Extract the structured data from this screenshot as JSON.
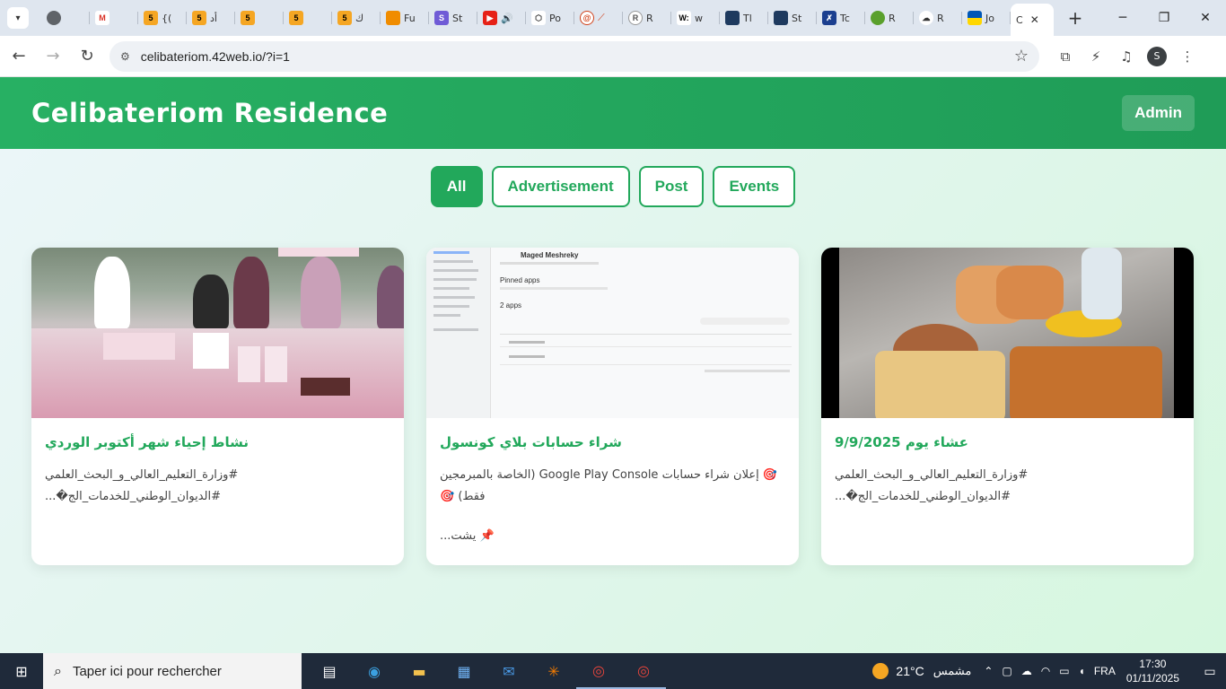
{
  "browser": {
    "tabs": [
      {
        "label": "",
        "icon": "globe-icon"
      },
      {
        "label": "M",
        "icon": "gmail-icon"
      },
      {
        "label": "{(",
        "icon": "five-icon"
      },
      {
        "label": "أد",
        "icon": "five-icon"
      },
      {
        "label": "",
        "icon": "five-icon"
      },
      {
        "label": "",
        "icon": "five-icon"
      },
      {
        "label": "ك",
        "icon": "five-icon"
      },
      {
        "label": "Fu",
        "icon": "fiverr-icon"
      },
      {
        "label": "St",
        "icon": "s-icon"
      },
      {
        "label": "",
        "icon": "youtube-icon"
      },
      {
        "label": "Po",
        "icon": "cube-icon"
      },
      {
        "label": "",
        "icon": "spiral-icon"
      },
      {
        "label": "R",
        "icon": "r-icon"
      },
      {
        "label": "w",
        "icon": "w-icon"
      },
      {
        "label": "Tl",
        "icon": "book-icon"
      },
      {
        "label": "St",
        "icon": "book-icon"
      },
      {
        "label": "Tc",
        "icon": "t-icon"
      },
      {
        "label": "R",
        "icon": "leaf-icon"
      },
      {
        "label": "R",
        "icon": "cloud-icon"
      },
      {
        "label": "Jo",
        "icon": "flag-icon"
      }
    ],
    "active_tab_label": "C",
    "url": "celibateriom.42web.io/?i=1"
  },
  "site": {
    "title": "Celibateriom Residence",
    "admin_label": "Admin",
    "filters": [
      "All",
      "Advertisement",
      "Post",
      "Events"
    ],
    "active_filter": "All"
  },
  "posts": [
    {
      "title": "نشاط إحياء شهر أكتوبر الوردي",
      "text": "#وزارة_التعليم_العالي_و_البحث_العلمي #الديوان_الوطني_للخدمات_الج�..."
    },
    {
      "title": "شراء حسابات بلاي كونسول",
      "text": "🎯 إعلان شراء حسابات Google Play Console (الخاصة بالمبرمجين فقط) 🎯",
      "text2": "📌 يشت..."
    },
    {
      "title": "عشاء يوم 9/9/2025",
      "text": "#وزارة_التعليم_العالي_و_البحث_العلمي #الديوان_الوطني_للخدمات_الج�..."
    }
  ],
  "console_image": {
    "account_name": "Maged Meshreky",
    "pinned": "Pinned apps",
    "apps_count": "2 apps"
  },
  "taskbar": {
    "search_placeholder": "Taper ici pour rechercher",
    "temperature": "21°C",
    "weather_label": "مشمس",
    "language": "FRA",
    "time": "17:30",
    "date": "01/11/2025"
  }
}
